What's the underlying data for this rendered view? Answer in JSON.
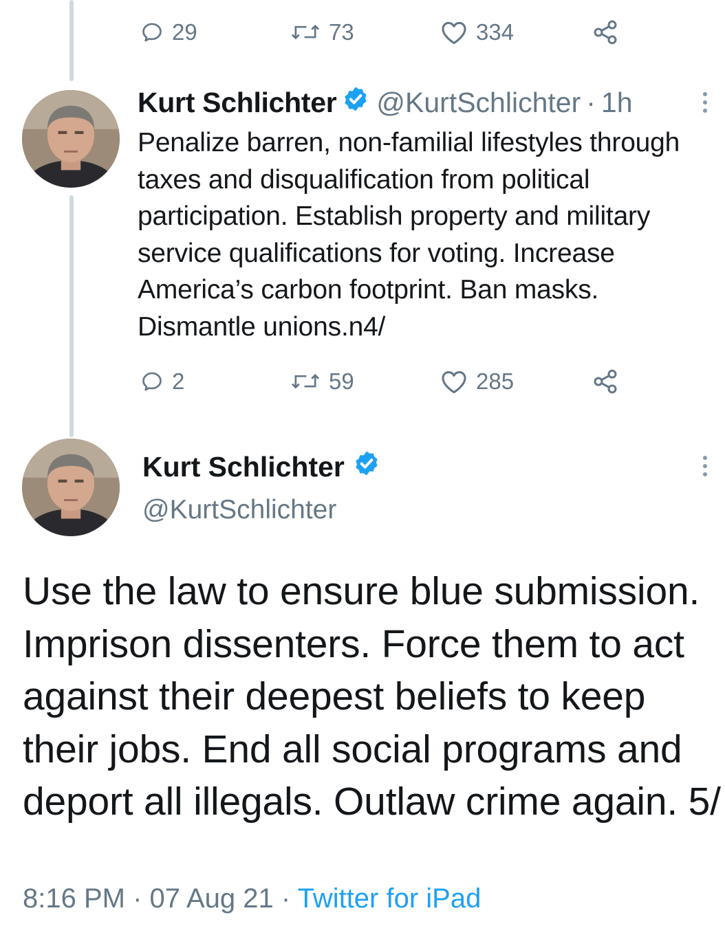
{
  "top_actions": {
    "replies": "29",
    "retweets": "73",
    "likes": "334"
  },
  "tweet4": {
    "name": "Kurt Schlichter",
    "handle": "@KurtSchlichter",
    "separator": "·",
    "time": "1h",
    "text": "Penalize barren, non-familial lifestyles through taxes and disqualification from political participation. Establish property and military service qualifications for voting. Increase America’s carbon footprint. Ban masks. Dismantle unions.n4/",
    "actions": {
      "replies": "2",
      "retweets": "59",
      "likes": "285"
    }
  },
  "tweet5": {
    "name": "Kurt Schlichter",
    "handle": "@KurtSchlichter",
    "text": "Use the law to ensure blue submission. Imprison dissenters. Force them to act against their deepest beliefs to keep their jobs. End all social programs and deport all illegals. Outlaw crime again. 5/",
    "time": "8:16 PM",
    "date": "07 Aug 21",
    "separator": "·",
    "source": "Twitter for iPad"
  },
  "colors": {
    "accent": "#1da1f2",
    "muted": "#657786",
    "text": "#14171a",
    "thread_line": "#cfd9de"
  },
  "icons": [
    "reply-icon",
    "retweet-icon",
    "like-icon",
    "share-icon",
    "verified-badge-icon",
    "more-options-icon"
  ]
}
